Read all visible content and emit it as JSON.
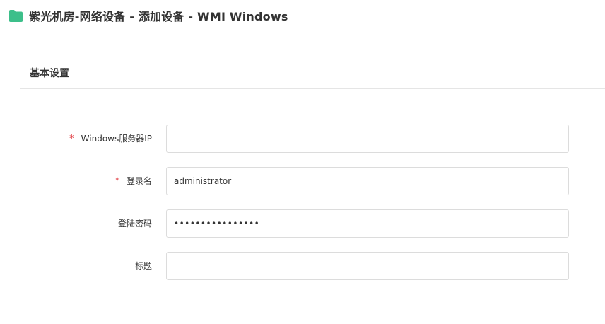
{
  "header": {
    "title": "紫光机房-网络设备 - 添加设备 - WMI Windows",
    "icon": "folder-icon",
    "icon_color": "#3dbf8a"
  },
  "section": {
    "title": "基本设置"
  },
  "form": {
    "fields": [
      {
        "label": "Windows服务器IP",
        "required": true,
        "value": "",
        "type": "text"
      },
      {
        "label": "登录名",
        "required": true,
        "value": "administrator",
        "type": "text"
      },
      {
        "label": "登陆密码",
        "required": false,
        "value": "1234567890123456",
        "type": "password"
      },
      {
        "label": "标题",
        "required": false,
        "value": "",
        "type": "text"
      }
    ],
    "required_mark": "*",
    "required_color": "#e0383e"
  }
}
